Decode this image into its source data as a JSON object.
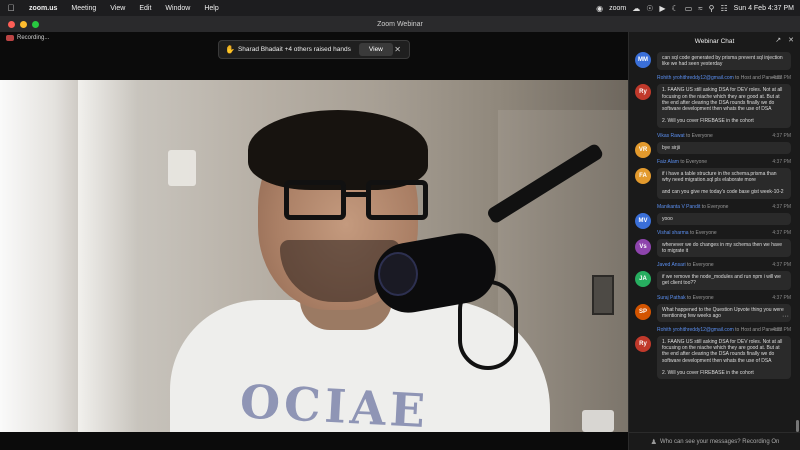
{
  "menubar": {
    "app": "zoom.us",
    "items": [
      "Meeting",
      "View",
      "Edit",
      "Window",
      "Help"
    ],
    "tray_label": "zoom",
    "datetime": "Sun 4 Feb  4:37 PM"
  },
  "window": {
    "title": "Zoom Webinar"
  },
  "stage": {
    "recording": "Recording...",
    "raised_hands": "Sharad Bhadait +4 others raised hands",
    "view_label": "View"
  },
  "video": {
    "shirt_print": "OCIAE"
  },
  "chat": {
    "title": "Webinar Chat",
    "footer": "Who can see your messages? Recording On",
    "messages": [
      {
        "initials": "MM",
        "color": "#3a6fd8",
        "sender": "",
        "to": "",
        "time": "",
        "text": "can sql code generated by prisma prevent sql injection like we had seen yesterday"
      },
      {
        "initials": "Ry",
        "color": "#c0392b",
        "sender": "Rohith yrohithreddy12@gmail.com",
        "to": "to Host and Panelists",
        "time": "4:37 PM",
        "text": "1. FAANG US still asking DSA for DEV roles. Not at all focusing on the niache which they are good at. But at the end after clearing the DSA rounds finally we do software development then whats the use of DSA\n\n2. Will you cover FIREBASE in the cohort"
      },
      {
        "initials": "VR",
        "color": "#e39a2d",
        "sender": "Vikas Rawat",
        "to": "to Everyone",
        "time": "4:37 PM",
        "text": "bye sirjii"
      },
      {
        "initials": "FA",
        "color": "#e39a2d",
        "sender": "Faiz Alam",
        "to": "to Everyone",
        "time": "4:37 PM",
        "text": "if i have a table structure in the schema.prisma than why need migration.sql pls elaborate more\n\nand can you give me today's code base gist week-10-2"
      },
      {
        "initials": "MV",
        "color": "#3a6fd8",
        "sender": "Manikanta V Pandit",
        "to": "to Everyone",
        "time": "4:37 PM",
        "text": "yooo"
      },
      {
        "initials": "Vs",
        "color": "#8e44ad",
        "sender": "Vishal sharma",
        "to": "to Everyone",
        "time": "4:37 PM",
        "text": "whenever we do changes in my schema then we have to migrate it"
      },
      {
        "initials": "JA",
        "color": "#27ae60",
        "sender": "Javed Ansari",
        "to": "to Everyone",
        "time": "4:37 PM",
        "text": "if we remove the node_modules and run npm i will we get client too??"
      },
      {
        "initials": "SP",
        "color": "#d35400",
        "sender": "Suraj Pathak",
        "to": "to Everyone",
        "time": "4:37 PM",
        "text": "What happened to the Question Upvote thing you were mentioning few weeks ago",
        "more": "···"
      },
      {
        "initials": "Ry",
        "color": "#c0392b",
        "sender": "Rohith yrohithreddy12@gmail.com",
        "to": "to Host and Panelists",
        "time": "4:37 PM",
        "text": "1. FAANG US still asking DSA for DEV roles. Not at all focusing on the niache which they are good at. But at the end after clearing the DSA rounds finally we do software development then whats the use of DSA\n\n2. Will you cover FIREBASE in the cohort"
      }
    ]
  }
}
